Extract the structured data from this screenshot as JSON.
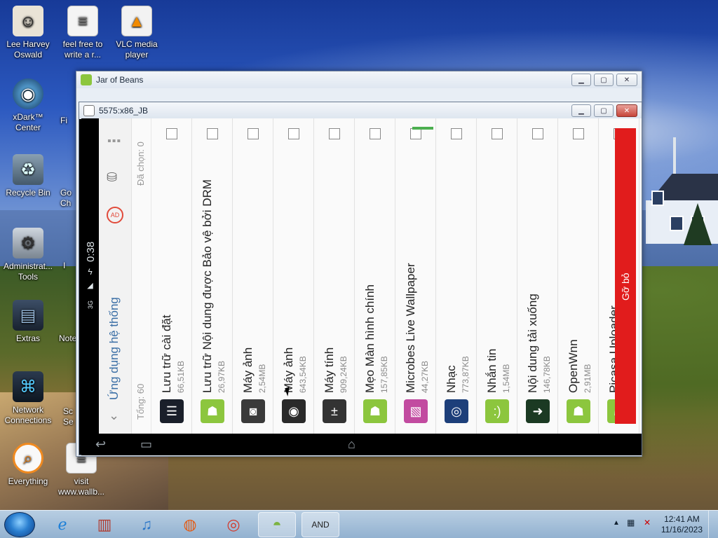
{
  "desktop": {
    "icons": [
      {
        "label": "Lee Harvey Oswald",
        "icon": "person-icon"
      },
      {
        "label": "feel free to write a r...",
        "icon": "document-icon"
      },
      {
        "label": "VLC media player",
        "icon": "vlc-icon"
      },
      {
        "label": "xDark™ Center",
        "icon": "xdark-icon"
      },
      {
        "label": "Recycle Bin",
        "icon": "recycle-bin-icon"
      },
      {
        "label": "Administrat... Tools",
        "icon": "admin-tools-icon"
      },
      {
        "label": "Extras",
        "icon": "folder-icon"
      },
      {
        "label": "Network Connections",
        "icon": "network-icon"
      },
      {
        "label": "Everything",
        "icon": "search-icon"
      },
      {
        "label": "visit www.wallb...",
        "icon": "document-icon"
      }
    ],
    "partial_labels": [
      "Fi",
      "Go Ch",
      "I",
      "Note",
      "Sc Se"
    ]
  },
  "outer_window": {
    "title": "Jar of Beans"
  },
  "inner_window": {
    "title": "5575:x86_JB"
  },
  "android": {
    "status": {
      "time": "0:38",
      "signal": "3G"
    },
    "header": {
      "title": "Ứng dụng hệ thống"
    },
    "summary": {
      "total": "Tổng: 60",
      "selected": "Đã chọn: 0"
    },
    "apps": [
      {
        "name": "Lưu trữ cài đặt",
        "size": "66,51KB",
        "icon": "settings-sliders-icon",
        "color": "#1a1f2a"
      },
      {
        "name": "Lưu trữ Nội dung được Bảo vệ bởi DRM",
        "size": "26,97KB",
        "icon": "android-icon",
        "color": "#8cc63e"
      },
      {
        "name": "Máy ảnh",
        "size": "2,54MB",
        "icon": "camera-icon",
        "color": "#3a3a3a"
      },
      {
        "name": "Máy ảnh",
        "size": "643,54KB",
        "icon": "camera-lens-icon",
        "color": "#2a2a2a"
      },
      {
        "name": "Máy tính",
        "size": "909,24KB",
        "icon": "calculator-icon",
        "color": "#333333"
      },
      {
        "name": "Mẹo Màn hình chính",
        "size": "157,85KB",
        "icon": "android-icon",
        "color": "#8cc63e"
      },
      {
        "name": "Microbes Live Wallpaper",
        "size": "44,27KB",
        "icon": "wallpaper-icon",
        "color": "#c24ba0"
      },
      {
        "name": "Nhạc",
        "size": "773,87KB",
        "icon": "music-icon",
        "color": "#1d3f7a"
      },
      {
        "name": "Nhắn tin",
        "size": "1,54MB",
        "icon": "messaging-icon",
        "color": "#8cc63e"
      },
      {
        "name": "Nội dung tải xuống",
        "size": "146,78KB",
        "icon": "download-icon",
        "color": "#1b3a23"
      },
      {
        "name": "OpenWnn",
        "size": "2,91MB",
        "icon": "android-icon",
        "color": "#8cc63e"
      },
      {
        "name": "Picasa Uploader",
        "size": "",
        "icon": "android-icon",
        "color": "#8cc63e"
      }
    ],
    "uninstall_label": "Gỡ bỏ",
    "accent": "#e11c1c",
    "green": "#4caf50"
  },
  "taskbar": {
    "items": [
      "internet-explorer-icon",
      "app-icon",
      "itunes-icon",
      "firefox-icon",
      "chrome-icon",
      "android-app-icon",
      "and-emulator-icon"
    ],
    "clock_time": "12:41 AM",
    "clock_date": "11/16/2023"
  }
}
